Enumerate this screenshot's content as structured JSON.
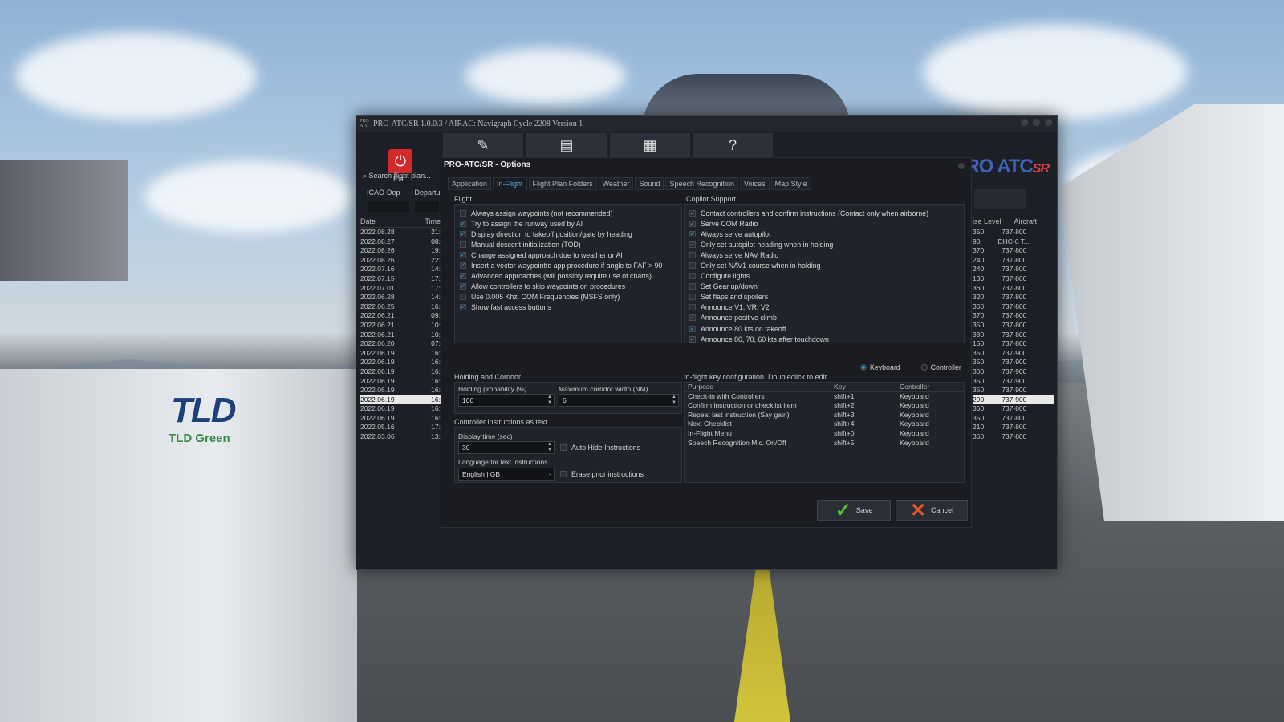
{
  "window": {
    "title": "PRO-ATC/SR 1.0.0.3 / AIRAC: Navigraph Cycle 2208 Version 1",
    "logo_text": "PRO ATC",
    "logo_suffix": "SR"
  },
  "toolbar": {
    "exit_label": "Exit",
    "icons": [
      "power-icon",
      "settings-wrench-icon",
      "flightplan-book-icon",
      "airport-chart-icon",
      "help-icon"
    ]
  },
  "left_panel": {
    "search_label": "Search flight plan...",
    "filter_headers": [
      "ICAO-Dep",
      "Departu"
    ],
    "columns": [
      "Date",
      "Time"
    ],
    "rows": [
      {
        "date": "2022.08.28",
        "time": "21:"
      },
      {
        "date": "2022.08.27",
        "time": "08:"
      },
      {
        "date": "2022.08.26",
        "time": "19:"
      },
      {
        "date": "2022.08.26",
        "time": "22:"
      },
      {
        "date": "2022.07.16",
        "time": "14:"
      },
      {
        "date": "2022.07.15",
        "time": "17:"
      },
      {
        "date": "2022.07.01",
        "time": "17:"
      },
      {
        "date": "2022.06.28",
        "time": "14:"
      },
      {
        "date": "2022.06.25",
        "time": "16:"
      },
      {
        "date": "2022.06.21",
        "time": "09:"
      },
      {
        "date": "2022.06.21",
        "time": "10:"
      },
      {
        "date": "2022.06.21",
        "time": "10:"
      },
      {
        "date": "2022.06.20",
        "time": "07:"
      },
      {
        "date": "2022.06.19",
        "time": "16:"
      },
      {
        "date": "2022.06.19",
        "time": "16:"
      },
      {
        "date": "2022.06.19",
        "time": "16:"
      },
      {
        "date": "2022.06.19",
        "time": "16:"
      },
      {
        "date": "2022.06.19",
        "time": "16:"
      },
      {
        "date": "2022.06.19",
        "time": "16:"
      },
      {
        "date": "2022.06.19",
        "time": "16:"
      },
      {
        "date": "2022.06.19",
        "time": "16:"
      },
      {
        "date": "2022.05.16",
        "time": "17:"
      },
      {
        "date": "2022.03.06",
        "time": "13:"
      }
    ],
    "selected_index": 18
  },
  "right_panel": {
    "columns": [
      "ise Level",
      "Aircraft"
    ],
    "rows": [
      {
        "level": "350",
        "aircraft": "737-800"
      },
      {
        "level": "90",
        "aircraft": "DHC-6 T..."
      },
      {
        "level": "370",
        "aircraft": "737-800"
      },
      {
        "level": "240",
        "aircraft": "737-800"
      },
      {
        "level": "240",
        "aircraft": "737-800"
      },
      {
        "level": "130",
        "aircraft": "737-800"
      },
      {
        "level": "360",
        "aircraft": "737-800"
      },
      {
        "level": "320",
        "aircraft": "737-800"
      },
      {
        "level": "360",
        "aircraft": "737-800"
      },
      {
        "level": "370",
        "aircraft": "737-800"
      },
      {
        "level": "350",
        "aircraft": "737-800"
      },
      {
        "level": "380",
        "aircraft": "737-800"
      },
      {
        "level": "150",
        "aircraft": "737-800"
      },
      {
        "level": "350",
        "aircraft": "737-900"
      },
      {
        "level": "350",
        "aircraft": "737-900"
      },
      {
        "level": "300",
        "aircraft": "737-900"
      },
      {
        "level": "350",
        "aircraft": "737-900"
      },
      {
        "level": "350",
        "aircraft": "737-900"
      },
      {
        "level": "290",
        "aircraft": "737-900"
      },
      {
        "level": "360",
        "aircraft": "737-800"
      },
      {
        "level": "350",
        "aircraft": "737-800"
      },
      {
        "level": "210",
        "aircraft": "737-800"
      },
      {
        "level": "360",
        "aircraft": "737-800"
      }
    ],
    "selected_index": 18
  },
  "options": {
    "title": "PRO-ATC/SR - Options",
    "tabs": [
      "Application",
      "In-Flight",
      "Flight Plan Folders",
      "Weather",
      "Sound",
      "Speech Recognition",
      "Voices",
      "Map Style"
    ],
    "active_tab": 1,
    "flight": {
      "title": "Flight",
      "items": [
        {
          "label": "Always assign waypoints (not recommended)",
          "checked": false
        },
        {
          "label": "Try to assign the runway used by AI",
          "checked": true
        },
        {
          "label": "Display direction to takeoff position/gate by heading",
          "checked": true
        },
        {
          "label": "Manual descent initialization (TOD)",
          "checked": false
        },
        {
          "label": "Change assigned approach due to weather or AI",
          "checked": true
        },
        {
          "label": "Insert a vector waypointto app procedure if angle to FAF > 90",
          "checked": true
        },
        {
          "label": "Advanced approaches (will possibly require use of charts)",
          "checked": true
        },
        {
          "label": "Allow controllers to skip waypoints on procedures",
          "checked": true
        },
        {
          "label": "Use 0.005 Khz. COM Frequencies (MSFS only)",
          "checked": false
        },
        {
          "label": "Show fast access buttons",
          "checked": true
        }
      ]
    },
    "copilot": {
      "title": "Copilot Support",
      "items": [
        {
          "label": "Contact controllers and confirm instructions (Contact only when airborne)",
          "checked": true
        },
        {
          "label": "Serve COM Radio",
          "checked": true
        },
        {
          "label": "Always serve autopilot",
          "checked": true
        },
        {
          "label": "Only set autopilot heading when in holding",
          "checked": true
        },
        {
          "label": "Always serve NAV Radio",
          "checked": false
        },
        {
          "label": "Only set NAV1 course when in holding",
          "checked": false
        },
        {
          "label": "Configure lights",
          "checked": false
        },
        {
          "label": "Set Gear up/down",
          "checked": false
        },
        {
          "label": "Set flaps and spoilers",
          "checked": false
        },
        {
          "label": "Announce V1, VR, V2",
          "checked": false
        },
        {
          "label": "Announce positive climb",
          "checked": true
        },
        {
          "label": "Announce 80 kts on takeoff",
          "checked": true
        },
        {
          "label": "Announce 80, 70, 60 kts after touchdown",
          "checked": true
        }
      ]
    },
    "holding": {
      "title": "Holding and Corridor",
      "prob_label": "Holding probability (%)",
      "prob_value": "100",
      "width_label": "Maximum corridor width (NM)",
      "width_value": "6"
    },
    "instructions": {
      "title": "Controller instructions as text",
      "display_label": "Display time (sec)",
      "display_value": "30",
      "auto_hide_label": "Auto Hide Instructions",
      "auto_hide_checked": false,
      "language_label": "Language for text instructions",
      "language_value": "English | GB",
      "erase_label": "Erase prior instructions",
      "erase_checked": false
    },
    "input": {
      "keyboard_label": "Keyboard",
      "controller_label": "Controller",
      "selected": "Keyboard"
    },
    "keys": {
      "title": "In-flight key configuration. Doubleclick to edit...",
      "headers": [
        "Purpose",
        "Key",
        "Controller"
      ],
      "rows": [
        {
          "purpose": "Check-in with Controllers",
          "key": "shift+1",
          "controller": "Keyboard"
        },
        {
          "purpose": "Confirm instruction or checklist item",
          "key": "shift+2",
          "controller": "Keyboard"
        },
        {
          "purpose": "Repeat last instruction (Say gain)",
          "key": "shift+3",
          "controller": "Keyboard"
        },
        {
          "purpose": "Next Checklist",
          "key": "shift+4",
          "controller": "Keyboard"
        },
        {
          "purpose": "In-Flight Menu",
          "key": "shift+0",
          "controller": "Keyboard"
        },
        {
          "purpose": "Speech Recognition Mic. On/Off",
          "key": "shift+5",
          "controller": "Keyboard"
        }
      ]
    },
    "save_label": "Save",
    "cancel_label": "Cancel"
  },
  "background": {
    "logo_text": "TLD",
    "logo_sub": "TLD Green"
  }
}
